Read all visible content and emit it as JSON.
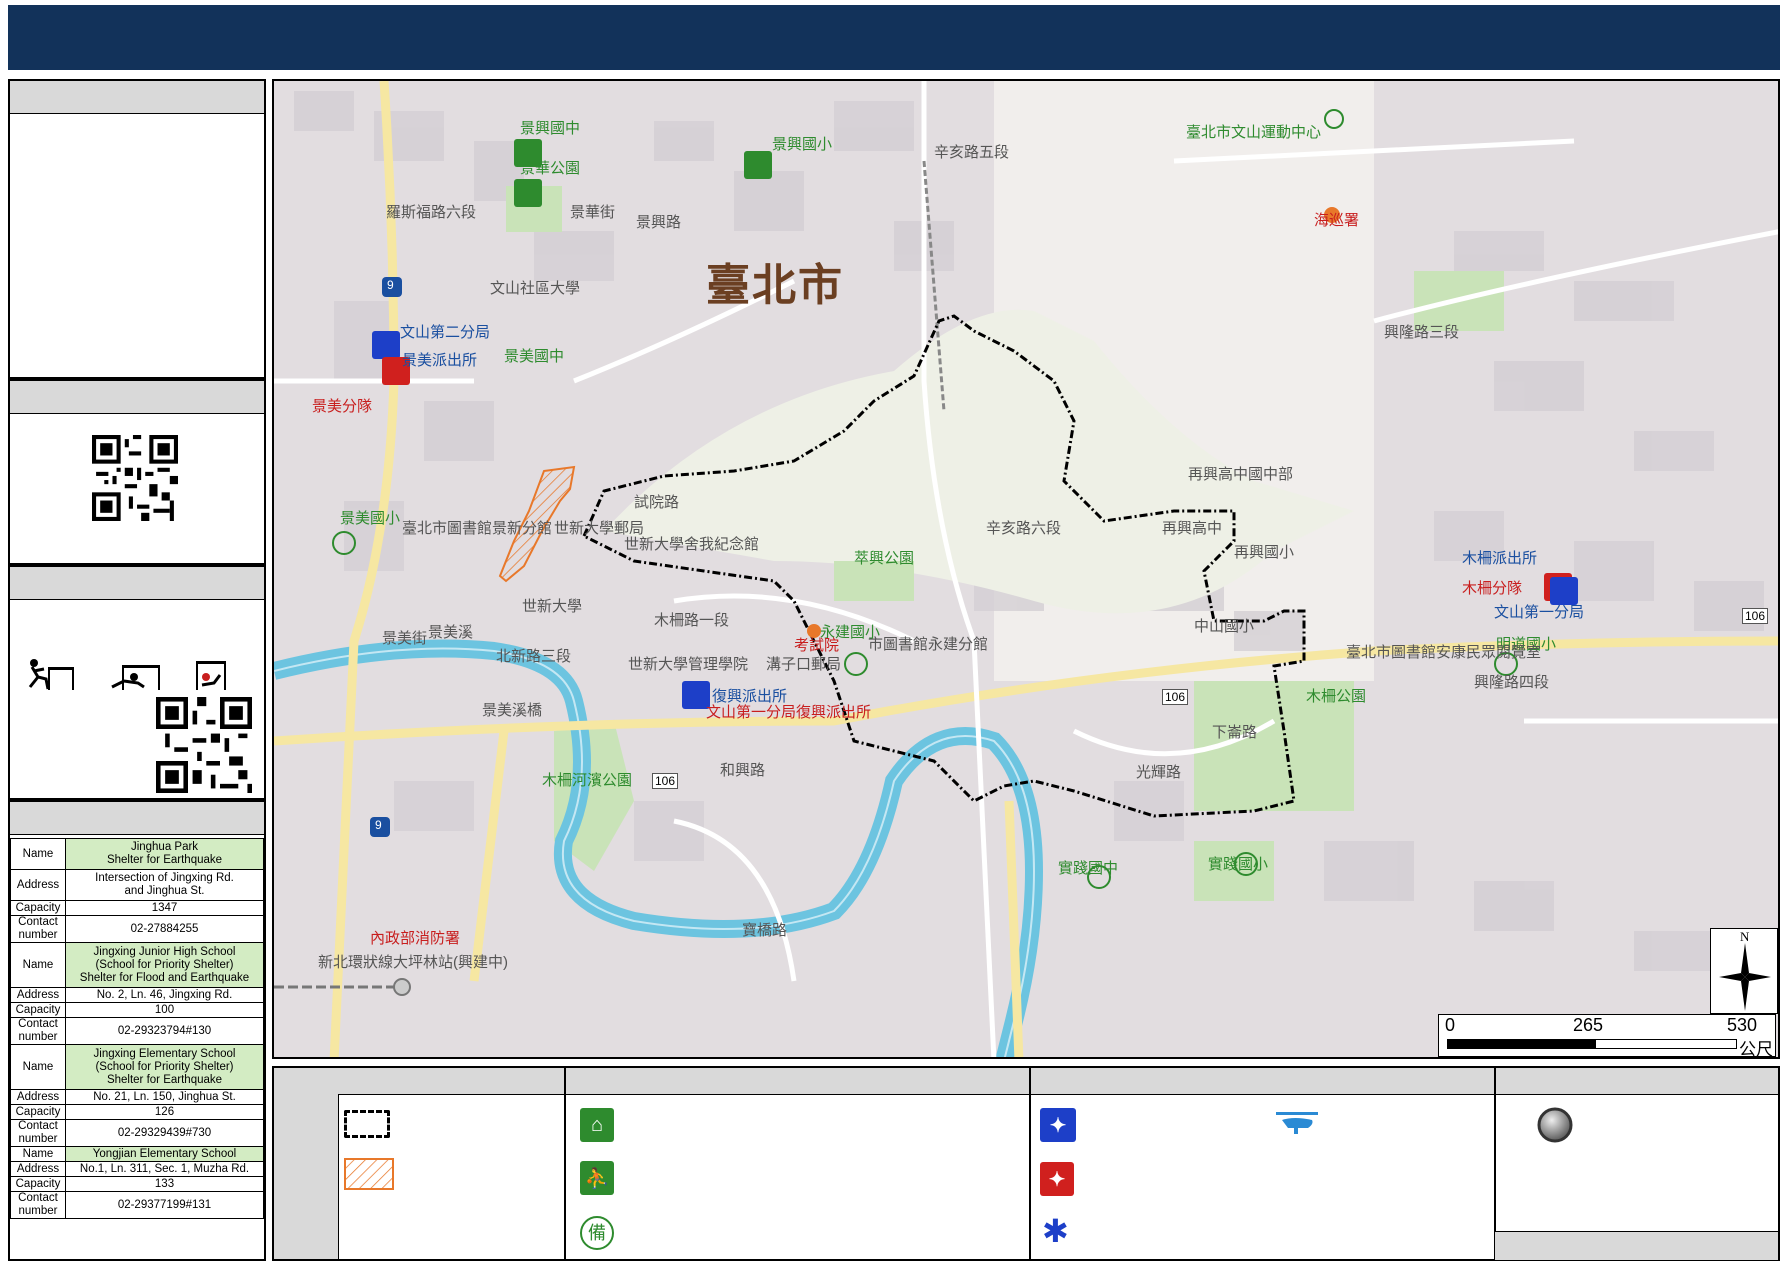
{
  "map": {
    "city_label": "臺北市",
    "labels": [
      {
        "text": "景興國中",
        "cls": "lbl-green"
      },
      {
        "text": "景華公園",
        "cls": "lbl-green"
      },
      {
        "text": "景興國小",
        "cls": "lbl-green"
      },
      {
        "text": "臺北市文山運動中心",
        "cls": "lbl-green"
      },
      {
        "text": "文山社區大學",
        "cls": "lbl-gray"
      },
      {
        "text": "文山第二分局",
        "cls": "lbl-blue"
      },
      {
        "text": "景美派出所",
        "cls": "lbl-blue"
      },
      {
        "text": "景美國中",
        "cls": "lbl-green"
      },
      {
        "text": "景美分隊",
        "cls": "lbl-red"
      },
      {
        "text": "景美國小",
        "cls": "lbl-green"
      },
      {
        "text": "臺北市圖書館景新分館",
        "cls": "lbl-gray"
      },
      {
        "text": "世新大學郵局",
        "cls": "lbl-gray"
      },
      {
        "text": "世新大學舍我紀念館",
        "cls": "lbl-gray"
      },
      {
        "text": "世新大學",
        "cls": "lbl-gray"
      },
      {
        "text": "景美溪",
        "cls": "lbl-gray"
      },
      {
        "text": "世新大學管理學院",
        "cls": "lbl-gray"
      },
      {
        "text": "復興派出所",
        "cls": "lbl-blue"
      },
      {
        "text": "文山第一分局復興派出所",
        "cls": "lbl-red"
      },
      {
        "text": "木柵河濱公園",
        "cls": "lbl-green"
      },
      {
        "text": "永建國小",
        "cls": "lbl-green"
      },
      {
        "text": "考試院",
        "cls": "lbl-red"
      },
      {
        "text": "市圖書館永建分館",
        "cls": "lbl-gray"
      },
      {
        "text": "溝子口郵局",
        "cls": "lbl-gray"
      },
      {
        "text": "萃興公園",
        "cls": "lbl-green"
      },
      {
        "text": "再興高中國中部",
        "cls": "lbl-gray"
      },
      {
        "text": "再興高中",
        "cls": "lbl-gray"
      },
      {
        "text": "再興國小",
        "cls": "lbl-gray"
      },
      {
        "text": "中山國小",
        "cls": "lbl-gray"
      },
      {
        "text": "木柵派出所",
        "cls": "lbl-blue"
      },
      {
        "text": "木柵分隊",
        "cls": "lbl-red"
      },
      {
        "text": "文山第一分局",
        "cls": "lbl-blue"
      },
      {
        "text": "明道國小",
        "cls": "lbl-green"
      },
      {
        "text": "臺北市圖書館安康民眾閱覽室",
        "cls": "lbl-gray"
      },
      {
        "text": "木柵公園",
        "cls": "lbl-green"
      },
      {
        "text": "實踐國中",
        "cls": "lbl-green"
      },
      {
        "text": "實踐國小",
        "cls": "lbl-green"
      },
      {
        "text": "內政部消防署",
        "cls": "lbl-red"
      },
      {
        "text": "新北環狀線大坪林站(興建中)",
        "cls": "lbl-gray"
      },
      {
        "text": "海巡署",
        "cls": "lbl-red"
      },
      {
        "text": "羅斯福路六段",
        "cls": "lbl-gray"
      },
      {
        "text": "辛亥路五段",
        "cls": "lbl-gray"
      },
      {
        "text": "辛亥路六段",
        "cls": "lbl-gray"
      },
      {
        "text": "北新路三段",
        "cls": "lbl-gray"
      },
      {
        "text": "興隆路三段",
        "cls": "lbl-gray"
      },
      {
        "text": "興隆路四段",
        "cls": "lbl-gray"
      },
      {
        "text": "景興路",
        "cls": "lbl-gray"
      },
      {
        "text": "景華街",
        "cls": "lbl-gray"
      },
      {
        "text": "試院路",
        "cls": "lbl-gray"
      },
      {
        "text": "木柵路一段",
        "cls": "lbl-gray"
      },
      {
        "text": "和興路",
        "cls": "lbl-gray"
      },
      {
        "text": "光輝路",
        "cls": "lbl-gray"
      },
      {
        "text": "下崙路",
        "cls": "lbl-gray"
      },
      {
        "text": "寶橋路",
        "cls": "lbl-gray"
      },
      {
        "text": "景美街",
        "cls": "lbl-gray"
      },
      {
        "text": "景美溪橋",
        "cls": "lbl-gray"
      }
    ],
    "route_numbers": [
      "9",
      "9",
      "106",
      "106",
      "106"
    ],
    "scale": {
      "ticks": [
        "0",
        "265",
        "530"
      ],
      "unit": "公尺"
    },
    "north": "N"
  },
  "shelters": [
    {
      "name_key": "Name",
      "name": "Jinghua Park\nShelter for Earthquake",
      "address_key": "Address",
      "address": "Intersection of Jingxing Rd.\nand Jinghua St.",
      "capacity_key": "Capacity",
      "capacity": "1347",
      "contact_key": "Contact\nnumber",
      "contact": "02-27884255"
    },
    {
      "name_key": "Name",
      "name": "Jingxing Junior High School\n(School for Priority Shelter)\nShelter for Flood and Earthquake",
      "address_key": "Address",
      "address": "No. 2, Ln. 46, Jingxing Rd.",
      "capacity_key": "Capacity",
      "capacity": "100",
      "contact_key": "Contact\nnumber",
      "contact": "02-29323794#130"
    },
    {
      "name_key": "Name",
      "name": "Jingxing Elementary School\n(School for Priority Shelter)\nShelter for Earthquake",
      "address_key": "Address",
      "address": "No. 21, Ln. 150, Jinghua St.",
      "capacity_key": "Capacity",
      "capacity": "126",
      "contact_key": "Contact\nnumber",
      "contact": "02-29329439#730"
    },
    {
      "name_key": "Name",
      "name": "Yongjian Elementary School",
      "address_key": "Address",
      "address": "No.1, Ln. 311, Sec. 1, Muzha Rd.",
      "capacity_key": "Capacity",
      "capacity": "133",
      "contact_key": "Contact\nnumber",
      "contact": "02-29377199#131"
    }
  ],
  "colors": {
    "header": "#12325a",
    "shelter_green": "#2e8b2e",
    "police_blue": "#1d3fc8",
    "fire_red": "#d0201e",
    "river": "#6cc4e0",
    "park": "#c9e3b8",
    "landslide": "#e8782a"
  }
}
